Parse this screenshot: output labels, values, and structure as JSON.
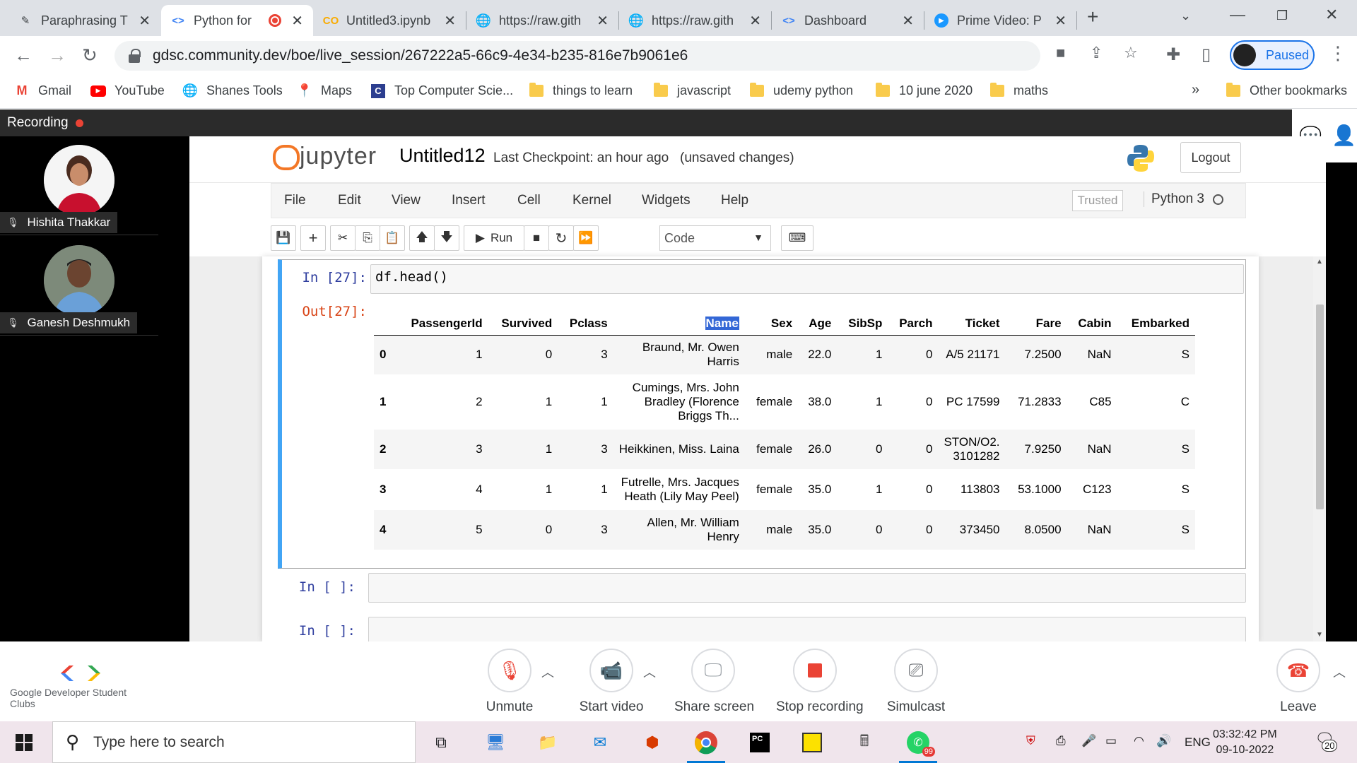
{
  "browser": {
    "tabs": [
      {
        "title": "Paraphrasing T",
        "icon": "pen-icon"
      },
      {
        "title": "Python for",
        "icon": "gdsc-icon",
        "recording": true
      },
      {
        "title": "Untitled3.ipynb",
        "icon": "colab-icon"
      },
      {
        "title": "https://raw.gith",
        "icon": "globe-icon"
      },
      {
        "title": "https://raw.gith",
        "icon": "globe-icon"
      },
      {
        "title": "Dashboard",
        "icon": "gdsc-icon"
      },
      {
        "title": "Prime Video: P",
        "icon": "prime-icon"
      }
    ],
    "url": "gdsc.community.dev/boe/live_session/267222a5-66c9-4e34-b235-816e7b9061e6",
    "profile_status": "Paused",
    "bookmarks": [
      "Gmail",
      "YouTube",
      "Shanes Tools",
      "Maps",
      "Top Computer Scie...",
      "things to learn",
      "javascript",
      "udemy python",
      "10 june 2020",
      "maths"
    ],
    "overflow": "»",
    "other_bookmarks": "Other bookmarks"
  },
  "meeting": {
    "recording_label": "Recording",
    "participants": [
      {
        "name": "Hishita Thakkar"
      },
      {
        "name": "Ganesh Deshmukh"
      }
    ],
    "controls": {
      "unmute": "Unmute",
      "start_video": "Start video",
      "share_screen": "Share screen",
      "stop_recording": "Stop recording",
      "simulcast": "Simulcast",
      "leave": "Leave"
    },
    "brand": "Google Developer Student Clubs"
  },
  "jupyter": {
    "logo_text": "jupyter",
    "notebook_name": "Untitled12",
    "checkpoint": "Last Checkpoint: an hour ago",
    "unsaved": "(unsaved changes)",
    "logout": "Logout",
    "menu": [
      "File",
      "Edit",
      "View",
      "Insert",
      "Cell",
      "Kernel",
      "Widgets",
      "Help"
    ],
    "trusted": "Trusted",
    "kernel": "Python 3",
    "toolbar": {
      "run": "Run",
      "cell_type": "Code"
    },
    "cells": {
      "in27_prompt": "In [27]:",
      "in27_code": "df.head()",
      "out27_prompt": "Out[27]:",
      "empty1_prompt": "In [ ]:",
      "empty2_prompt": "In [ ]:"
    },
    "table": {
      "columns": [
        "",
        "PassengerId",
        "Survived",
        "Pclass",
        "Name",
        "Sex",
        "Age",
        "SibSp",
        "Parch",
        "Ticket",
        "Fare",
        "Cabin",
        "Embarked"
      ],
      "rows": [
        [
          "0",
          "1",
          "0",
          "3",
          "Braund, Mr. Owen Harris",
          "male",
          "22.0",
          "1",
          "0",
          "A/5 21171",
          "7.2500",
          "NaN",
          "S"
        ],
        [
          "1",
          "2",
          "1",
          "1",
          "Cumings, Mrs. John Bradley (Florence Briggs Th...",
          "female",
          "38.0",
          "1",
          "0",
          "PC 17599",
          "71.2833",
          "C85",
          "C"
        ],
        [
          "2",
          "3",
          "1",
          "3",
          "Heikkinen, Miss. Laina",
          "female",
          "26.0",
          "0",
          "0",
          "STON/O2. 3101282",
          "7.9250",
          "NaN",
          "S"
        ],
        [
          "3",
          "4",
          "1",
          "1",
          "Futrelle, Mrs. Jacques Heath (Lily May Peel)",
          "female",
          "35.0",
          "1",
          "0",
          "113803",
          "53.1000",
          "C123",
          "S"
        ],
        [
          "4",
          "5",
          "0",
          "3",
          "Allen, Mr. William Henry",
          "male",
          "35.0",
          "0",
          "0",
          "373450",
          "8.0500",
          "NaN",
          "S"
        ]
      ]
    }
  },
  "taskbar": {
    "search_placeholder": "Type here to search",
    "language": "ENG",
    "time": "03:32:42 PM",
    "date": "09-10-2022",
    "notification_count": "20",
    "whatsapp_badge": "99"
  },
  "colors": {
    "jupyter_orange": "#f37726",
    "cell_selected": "#42a5f5",
    "recording_red": "#ea4335",
    "chrome_blue": "#1a73e8"
  }
}
